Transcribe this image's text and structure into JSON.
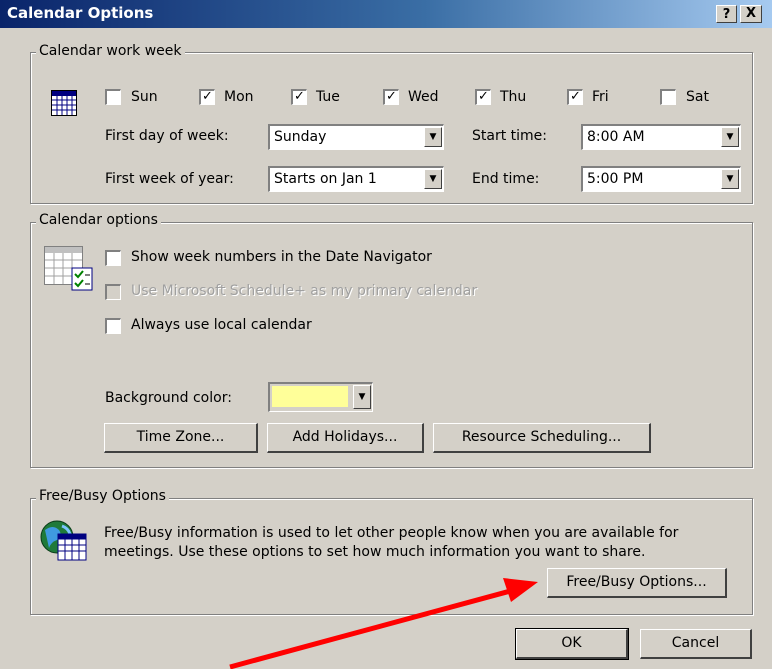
{
  "window": {
    "title": "Calendar Options",
    "help_label": "?",
    "close_label": "X"
  },
  "work_week": {
    "group_label": "Calendar work week",
    "days": [
      {
        "label": "Sun",
        "checked": false
      },
      {
        "label": "Mon",
        "checked": true
      },
      {
        "label": "Tue",
        "checked": true
      },
      {
        "label": "Wed",
        "checked": true
      },
      {
        "label": "Thu",
        "checked": true
      },
      {
        "label": "Fri",
        "checked": true
      },
      {
        "label": "Sat",
        "checked": false
      }
    ],
    "first_day_label": "First day of week:",
    "first_day_value": "Sunday",
    "first_week_label": "First week of year:",
    "first_week_value": "Starts on Jan 1",
    "start_time_label": "Start time:",
    "start_time_value": "8:00 AM",
    "end_time_label": "End time:",
    "end_time_value": "5:00 PM"
  },
  "options": {
    "group_label": "Calendar options",
    "show_week_numbers": "Show week numbers in the Date Navigator",
    "use_schedule_plus": "Use Microsoft Schedule+ as my primary calendar",
    "always_local": "Always use local calendar",
    "bg_color_label": "Background color:",
    "bg_color": "#ffff99",
    "time_zone_button": "Time Zone...",
    "add_holidays_button": "Add Holidays...",
    "resource_button": "Resource Scheduling..."
  },
  "freebusy": {
    "group_label": "Free/Busy Options",
    "description_line1": "Free/Busy information is used to let other people know when you are available for",
    "description_line2": "meetings.  Use these options to set how much information you want to share.",
    "button": "Free/Busy Options..."
  },
  "footer": {
    "ok": "OK",
    "cancel": "Cancel"
  },
  "annotation": {
    "arrow_color": "#ff0000"
  }
}
